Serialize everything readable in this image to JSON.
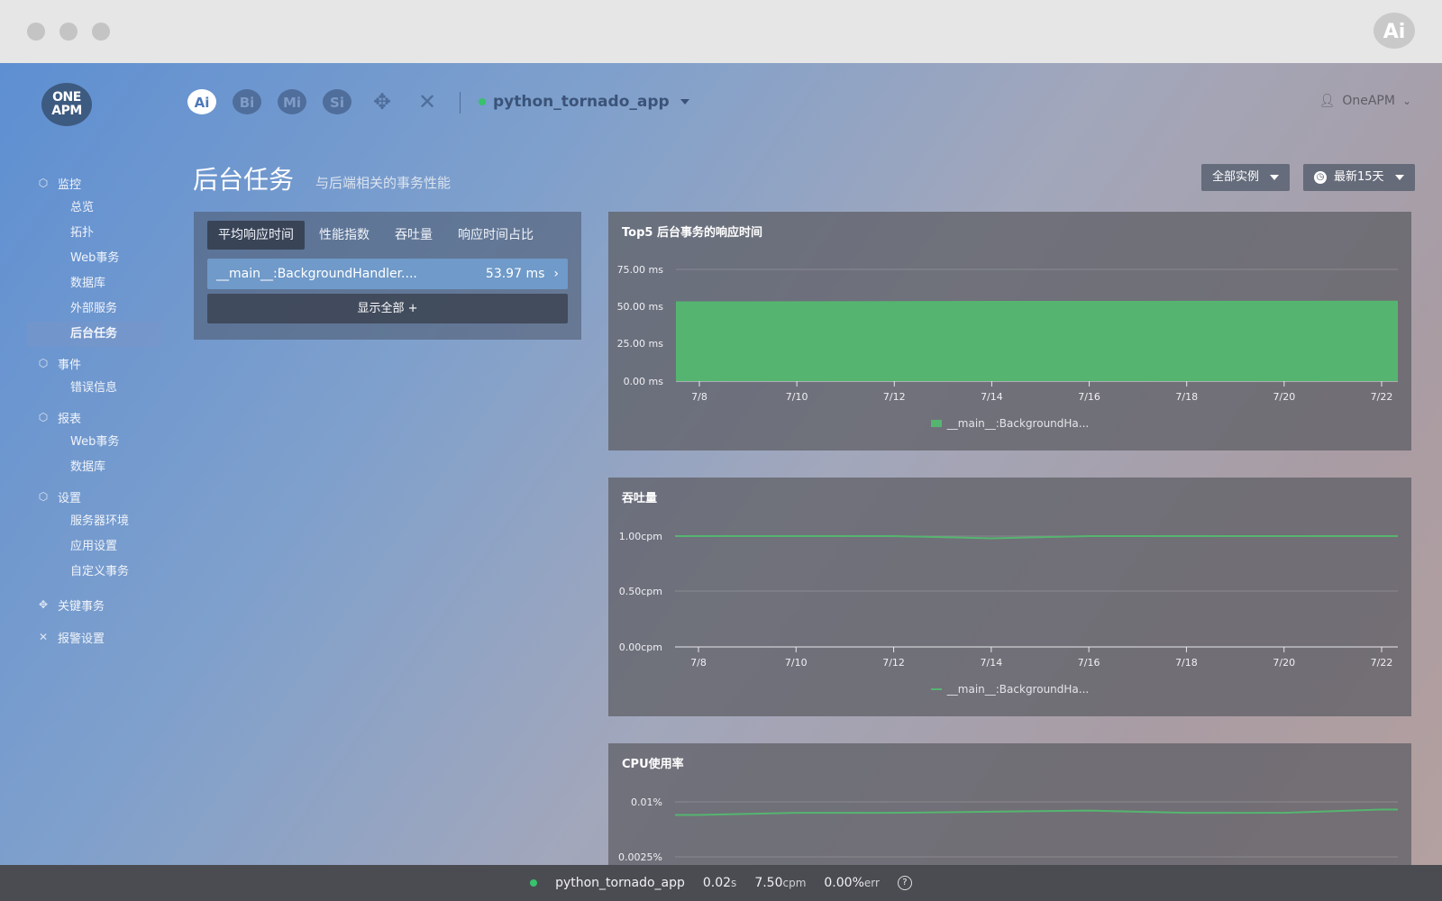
{
  "chrome": {
    "logo": "Ai"
  },
  "logo": {
    "line1": "ONE",
    "line2": "APM"
  },
  "product_icons": [
    {
      "label": "Ai",
      "name": "ai-product-icon",
      "active": true
    },
    {
      "label": "Bi",
      "name": "bi-product-icon",
      "active": false
    },
    {
      "label": "Mi",
      "name": "mi-product-icon",
      "active": false
    },
    {
      "label": "Si",
      "name": "si-product-icon",
      "active": false
    },
    {
      "label": "",
      "name": "handshake-icon",
      "glyph": "✥",
      "active": false
    },
    {
      "label": "",
      "name": "tools-icon",
      "glyph": "✕",
      "active": false
    }
  ],
  "app_name": "python_tornado_app",
  "user": "OneAPM",
  "sidebar": {
    "sections": [
      {
        "label": "监控",
        "icon": "cube-icon",
        "items": [
          "总览",
          "拓扑",
          "Web事务",
          "数据库",
          "外部服务",
          "后台任务"
        ]
      },
      {
        "label": "事件",
        "icon": "cube-icon",
        "items": [
          "错误信息"
        ]
      },
      {
        "label": "报表",
        "icon": "cube-icon",
        "items": [
          "Web事务",
          "数据库"
        ]
      },
      {
        "label": "设置",
        "icon": "cube-icon",
        "items": [
          "服务器环境",
          "应用设置",
          "自定义事务"
        ]
      },
      {
        "label": "关键事务",
        "icon": "handshake-icon",
        "items": []
      },
      {
        "label": "报警设置",
        "icon": "tools-icon",
        "items": []
      }
    ],
    "active_item": "后台任务"
  },
  "page": {
    "title": "后台任务",
    "subtitle": "与后端相关的事务性能"
  },
  "filters": {
    "instances": "全部实例",
    "time": "最新15天"
  },
  "left_panel": {
    "tabs": [
      "平均响应时间",
      "性能指数",
      "吞吐量",
      "响应时间占比"
    ],
    "active_tab": 0,
    "rows": [
      {
        "name": "__main__:BackgroundHandler....",
        "value": "53.97 ms"
      }
    ],
    "show_all": "显示全部 +"
  },
  "charts": {
    "c1": {
      "title": "Top5 后台事务的响应时间",
      "yticks": [
        "75.00 ms",
        "50.00 ms",
        "25.00 ms",
        "0.00 ms"
      ],
      "legend": "__main__:BackgroundHa..."
    },
    "c2": {
      "title": "吞吐量",
      "yticks": [
        "1.00cpm",
        "0.50cpm",
        "0.00cpm"
      ],
      "legend": "__main__:BackgroundHa..."
    },
    "c3": {
      "title": "CPU使用率",
      "yticks": [
        "0.01%",
        "0.0025%"
      ]
    },
    "xticks": [
      "7/8",
      "7/10",
      "7/12",
      "7/14",
      "7/16",
      "7/18",
      "7/20",
      "7/22"
    ]
  },
  "chart_data": [
    {
      "type": "area",
      "title": "Top5 后台事务的响应时间",
      "x": [
        "7/8",
        "7/10",
        "7/12",
        "7/14",
        "7/16",
        "7/18",
        "7/20",
        "7/22"
      ],
      "series": [
        {
          "name": "__main__:BackgroundHa...",
          "values": [
            53.5,
            53.6,
            53.7,
            53.8,
            53.8,
            53.9,
            53.9,
            54.0
          ]
        }
      ],
      "ylim": [
        0,
        75
      ],
      "ylabel": "",
      "color": "#55b570",
      "grid": true,
      "legend": "bottom"
    },
    {
      "type": "line",
      "title": "吞吐量",
      "x": [
        "7/8",
        "7/10",
        "7/12",
        "7/14",
        "7/16",
        "7/18",
        "7/20",
        "7/22"
      ],
      "series": [
        {
          "name": "__main__:BackgroundHa...",
          "values": [
            1.0,
            1.0,
            1.0,
            0.98,
            1.0,
            1.0,
            1.0,
            1.0
          ]
        }
      ],
      "ylim": [
        0,
        1.0
      ],
      "ylabel": "",
      "color": "#55b570",
      "grid": true,
      "legend": "bottom"
    },
    {
      "type": "line",
      "title": "CPU使用率",
      "x": [
        "7/8",
        "7/10",
        "7/12",
        "7/14",
        "7/16",
        "7/18",
        "7/20",
        "7/22"
      ],
      "series": [
        {
          "values": [
            0.0088,
            0.009,
            0.009,
            0.0091,
            0.0092,
            0.009,
            0.009,
            0.0093
          ]
        }
      ],
      "ylim": [
        0,
        0.01
      ],
      "color": "#55b570",
      "grid": true
    }
  ],
  "bottom_bar": {
    "app": "python_tornado_app",
    "resp_time": "0.02",
    "resp_unit": "s",
    "throughput": "7.50",
    "throughput_unit": "cpm",
    "error_rate": "0.00%",
    "error_unit": "err",
    "help": "?"
  }
}
